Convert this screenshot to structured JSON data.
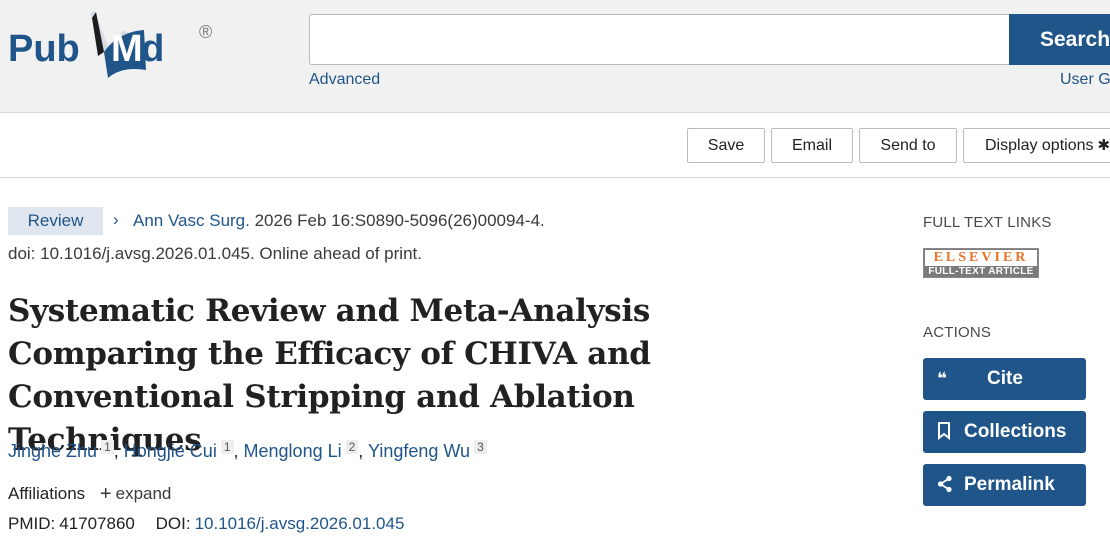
{
  "header": {
    "logo_text": "PubMed",
    "logo_mark": "®",
    "search_value": "",
    "search_button_label": "Search",
    "advanced_link": "Advanced",
    "user_guide_link": "User G"
  },
  "toolbar": {
    "save_label": "Save",
    "email_label": "Email",
    "send_to_label": "Send to",
    "display_options_label": "Display options",
    "display_options_icon": "gear-icon"
  },
  "article": {
    "type_badge": "Review",
    "journal": "Ann Vasc Surg.",
    "citation_rest": "2026 Feb 16:S0890-5096(26)00094-4.",
    "doi_line": "doi: 10.1016/j.avsg.2026.01.045. Online ahead of print.",
    "title": "Systematic Review and Meta-Analysis Comparing the Efficacy of CHIVA and Conventional Stripping and Ablation Techniques",
    "authors": [
      {
        "name": "Jinghe Zhu",
        "aff": "1"
      },
      {
        "name": "Hongjie Cui",
        "aff": "1"
      },
      {
        "name": "Menglong Li",
        "aff": "2"
      },
      {
        "name": "Yingfeng Wu",
        "aff": "3"
      }
    ],
    "affiliations_label": "Affiliations",
    "expand_label": "expand",
    "pmid_label": "PMID:",
    "pmid": "41707860",
    "doi_label": "DOI:",
    "doi": "10.1016/j.avsg.2026.01.045"
  },
  "sidebar": {
    "full_text_heading": "FULL TEXT LINKS",
    "elsevier_name": "ELSEVIER",
    "elsevier_sub": "FULL-TEXT ARTICLE",
    "actions_heading": "ACTIONS",
    "cite_label": "Cite",
    "collections_label": "Collections",
    "permalink_label": "Permalink"
  },
  "colors": {
    "brand_blue": "#20558a",
    "header_bg": "#f1f1f1",
    "badge_bg": "#dfe6ef",
    "elsevier_orange": "#e8742a"
  }
}
